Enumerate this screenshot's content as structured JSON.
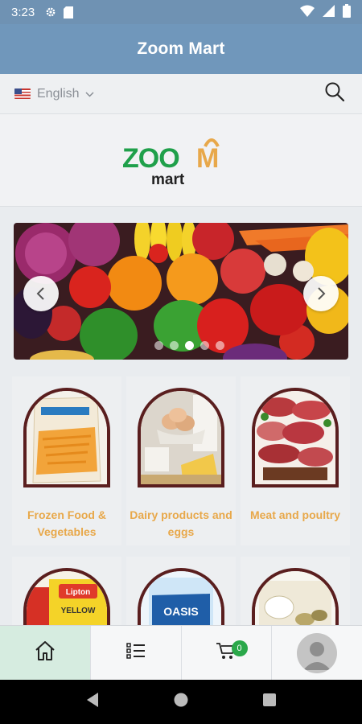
{
  "status_bar": {
    "time": "3:23"
  },
  "app_bar": {
    "title": "Zoom Mart"
  },
  "language": {
    "selected": "English"
  },
  "logo": {
    "word_top": "ZOOM",
    "word_bottom": "mart"
  },
  "banner": {
    "slide_count": 5,
    "active_index": 3
  },
  "categories": [
    {
      "label": "Frozen Food & Vegetables"
    },
    {
      "label": "Dairy products and eggs"
    },
    {
      "label": "Meat and poultry"
    },
    {
      "label": ""
    },
    {
      "label": ""
    },
    {
      "label": ""
    }
  ],
  "product_marks": {
    "lipton": "Lipton",
    "lipton_sub": "YELLOW",
    "oasis": "OASIS"
  },
  "cart": {
    "count": "0"
  },
  "colors": {
    "app_bar": "#7097bb",
    "accent_label": "#e8a84a",
    "arch_border": "#5a1e1e",
    "badge": "#2aa84a",
    "active_nav": "#d6ece0"
  }
}
